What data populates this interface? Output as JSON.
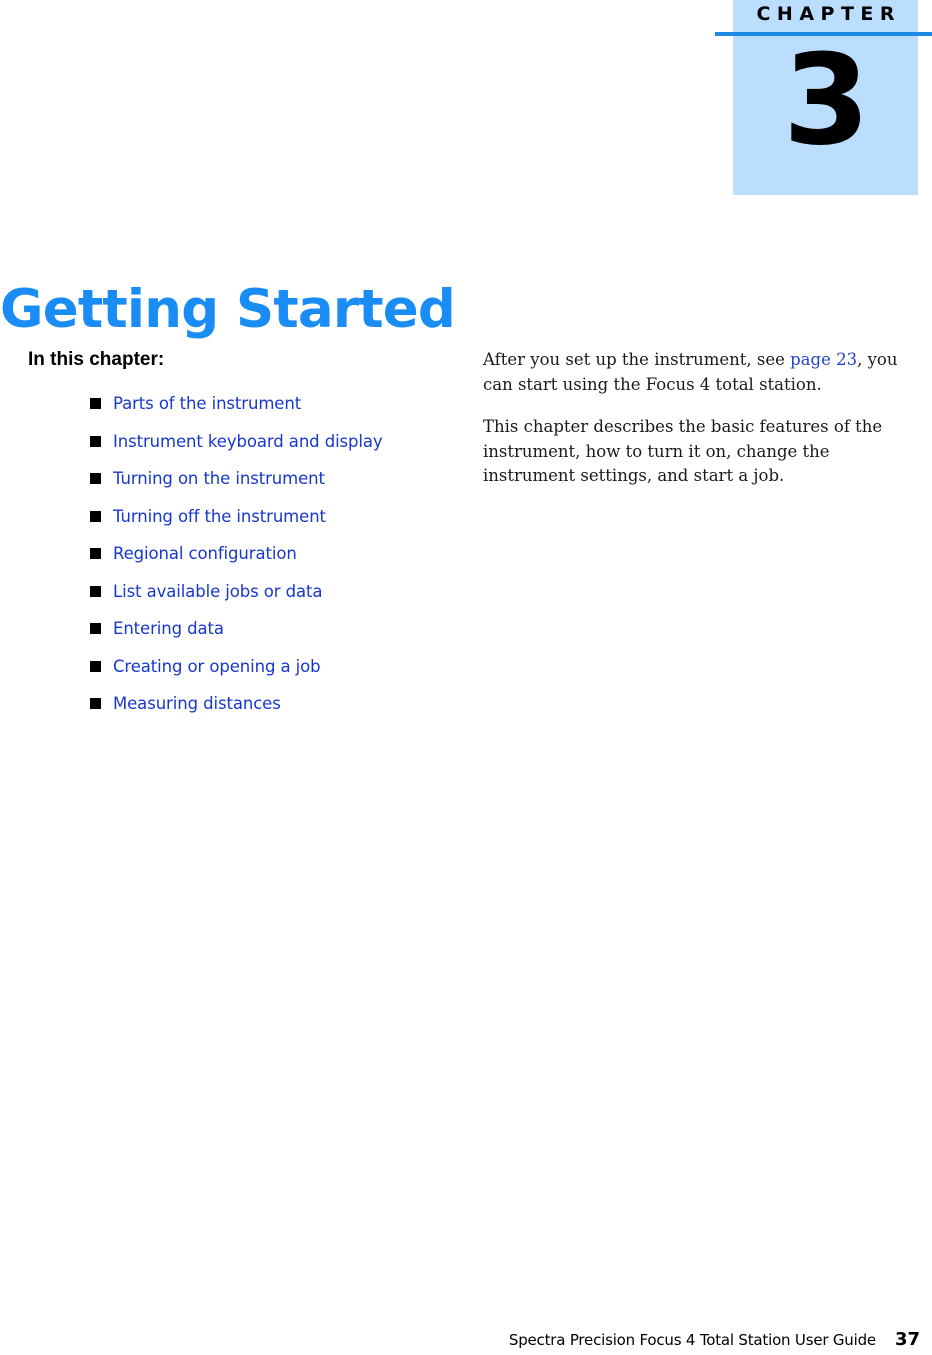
{
  "chapter_marker": {
    "label": "CHAPTER",
    "number": "3",
    "box_color": "#bbdeff",
    "rule_color": "#1e88e5"
  },
  "title": {
    "text": "Getting Started",
    "color": "#1a8cf5"
  },
  "left_column": {
    "heading": "In this chapter:",
    "bullet_glyph": "square-bullet",
    "link_color": "#1638cc",
    "items": [
      {
        "label": "Parts of the instrument"
      },
      {
        "label": "Instrument keyboard and display"
      },
      {
        "label": "Turning on the instrument"
      },
      {
        "label": "Turning off the instrument"
      },
      {
        "label": "Regional configuration"
      },
      {
        "label": "List available jobs or data"
      },
      {
        "label": "Entering data"
      },
      {
        "label": "Creating or opening a job"
      },
      {
        "label": "Measuring distances"
      }
    ]
  },
  "right_column": {
    "paragraph1": {
      "before_link": "After you set up the instrument, see ",
      "link": "page 23",
      "after_link": ", you can start using the Focus 4 total station."
    },
    "paragraph2": "This chapter describes the basic features of the instrument, how to turn it on, change the instrument settings, and start a job."
  },
  "footer": {
    "guide_title": "Spectra Precision Focus 4 Total Station User Guide",
    "page_number": "37"
  }
}
